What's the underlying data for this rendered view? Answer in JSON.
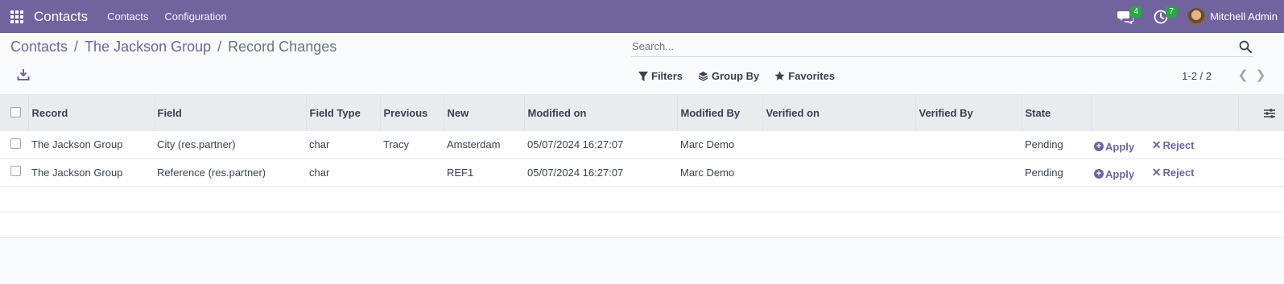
{
  "navbar": {
    "app_name": "Contacts",
    "menu": [
      "Contacts",
      "Configuration"
    ],
    "messages_count": "4",
    "activities_count": "7",
    "user_name": "Mitchell Admin",
    "bg_color": "#71639e"
  },
  "breadcrumb": {
    "items": [
      "Contacts",
      "The Jackson Group"
    ],
    "current": "Record Changes"
  },
  "search": {
    "placeholder": "Search..."
  },
  "filters": {
    "filters_label": "Filters",
    "group_by_label": "Group By",
    "favorites_label": "Favorites"
  },
  "pager": {
    "text": "1-2 / 2"
  },
  "table": {
    "columns": [
      "Record",
      "Field",
      "Field Type",
      "Previous",
      "New",
      "Modified on",
      "Modified By",
      "Verified on",
      "Verified By",
      "State"
    ],
    "rows": [
      {
        "record": "The Jackson Group",
        "field": "City (res.partner)",
        "field_type": "char",
        "previous": "Tracy",
        "new": "Amsterdam",
        "modified_on": "05/07/2024 16:27:07",
        "modified_by": "Marc Demo",
        "verified_on": "",
        "verified_by": "",
        "state": "Pending"
      },
      {
        "record": "The Jackson Group",
        "field": "Reference (res.partner)",
        "field_type": "char",
        "previous": "",
        "new": "REF1",
        "modified_on": "05/07/2024 16:27:07",
        "modified_by": "Marc Demo",
        "verified_on": "",
        "verified_by": "",
        "state": "Pending"
      }
    ],
    "apply_label": "Apply",
    "reject_label": "Reject"
  }
}
